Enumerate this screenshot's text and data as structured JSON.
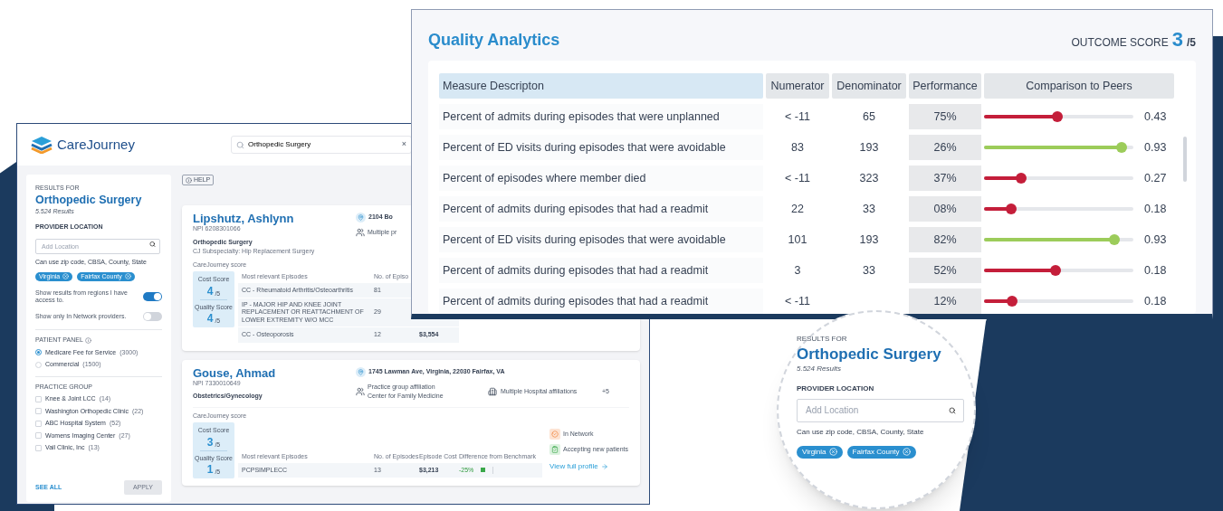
{
  "left_window": {
    "logo": "CareJourney",
    "search": {
      "value": "Orthopedic Surgery",
      "clear": "×"
    },
    "sidebar": {
      "results_for": "RESULTS FOR",
      "query": "Orthopedic Surgery",
      "count": "5.524 Results",
      "location_label": "PROVIDER LOCATION",
      "location_placeholder": "Add Location",
      "location_hint": "Can use zip code, CBSA, County, State",
      "tags": [
        "Virginia",
        "Fairfax County"
      ],
      "toggles": [
        {
          "label": "Show results from regions I have access to.",
          "on": true
        },
        {
          "label": "Show only In Network providers.",
          "on": false
        }
      ],
      "patient_panel": {
        "label": "PATIENT PANEL",
        "options": [
          {
            "label": "Medicare Fee for Service",
            "count": "(3000)",
            "selected": true
          },
          {
            "label": "Commercial",
            "count": "(1500)",
            "selected": false
          }
        ]
      },
      "practice_group": {
        "label": "PRACTICE GROUP",
        "options": [
          {
            "label": "Knee & Joint LCC",
            "count": "(14)",
            "checked": false
          },
          {
            "label": "Washington Orthopedic Clinic",
            "count": "(22)",
            "checked": false
          },
          {
            "label": "ABC Hospital System",
            "count": "(52)",
            "checked": false
          },
          {
            "label": "Womens Imaging Center",
            "count": "(27)",
            "checked": false
          },
          {
            "label": "Vail Clinic, Inc",
            "count": "(13)",
            "checked": false
          }
        ]
      },
      "see_all": "SEE ALL",
      "apply": {
        "label": "APPLY",
        "disabled": true
      }
    },
    "help": "HELP",
    "providers": [
      {
        "name": "Lipshutz, Ashlynn",
        "npi": "NPI 6208301066",
        "specialty": "Orthopedic Surgery",
        "subspecialty": "CJ Subspecialty: Hip Replacement Surgery",
        "address": "2104 Bo",
        "affiliation": "Multiple pr",
        "score_title": "CareJourney score",
        "cost_label": "Cost Score",
        "cost": "4",
        "quality_label": "Quality Score",
        "quality": "4",
        "cost_out_of": "/5",
        "quality_out_of": "/5",
        "columns": [
          "Most relevant Episodes",
          "No. of Episo"
        ],
        "episodes": [
          {
            "name": "CC - Rheumatoid Arthritis/Osteoarthritis",
            "count": "81"
          },
          {
            "name": "IP - MAJOR HIP AND KNEE JOINT REPLACEMENT OR REATTACHMENT OF LOWER EXTREMITY W/O MCC",
            "count": "29"
          },
          {
            "name": "CC - Osteoporosis",
            "count": "12",
            "cost": "$3,554"
          }
        ]
      },
      {
        "name": "Gouse, Ahmad",
        "npi": "NPI 7330010649",
        "specialty": "Obstetrics/Gynecology",
        "address": "1745 Lawman Ave, Virginia, 22030 Fairfax, VA",
        "group_label": "Practice group affiliation",
        "group": "Center for Family Medicine",
        "hospitals": "Multiple Hospital affiliations",
        "hospitals_more": "+5",
        "score_title": "CareJourney score",
        "cost_label": "Cost Score",
        "cost": "3",
        "quality_label": "Quality Score",
        "quality": "1",
        "cost_out_of": "/5",
        "quality_out_of": "/5",
        "columns": [
          "Most relevant Episodes",
          "No. of Episodes",
          "Episode Cost",
          "Difference from Benchmark"
        ],
        "episodes": [
          {
            "name": "PCPSIMPLECC",
            "count": "13",
            "cost": "$3,213",
            "difference": "-25%"
          }
        ],
        "badges": [
          "In Network",
          "Accepting new patients"
        ],
        "profile_link": "View full profile"
      }
    ]
  },
  "analytics": {
    "title": "Quality Analytics",
    "score_label": "OUTCOME SCORE",
    "score": "3",
    "score_of": "/5",
    "columns": [
      "Measure Descripton",
      "Numerator",
      "Denominator",
      "Performance",
      "Comparison to Peers"
    ],
    "rows": [
      {
        "measure": "Percent of admits during episodes that were unplanned",
        "numerator": "< -11",
        "denominator": "65",
        "performance": "75%",
        "level": 0.49,
        "color": "#c41e3a",
        "value": "0.43"
      },
      {
        "measure": "Percent of ED visits during episodes that were avoidable",
        "numerator": "83",
        "denominator": "193",
        "performance": "26%",
        "level": 0.92,
        "color": "#9ccc5a",
        "value": "0.93"
      },
      {
        "measure": "Percent of episodes where member died",
        "numerator": "< -11",
        "denominator": "323",
        "performance": "37%",
        "level": 0.25,
        "color": "#c41e3a",
        "value": "0.27"
      },
      {
        "measure": "Percent of admits during episodes that had a readmit",
        "numerator": "22",
        "denominator": "33",
        "performance": "08%",
        "level": 0.18,
        "color": "#c41e3a",
        "value": "0.18"
      },
      {
        "measure": "Percent of ED visits during episodes that were avoidable",
        "numerator": "101",
        "denominator": "193",
        "performance": "82%",
        "level": 0.87,
        "color": "#9ccc5a",
        "value": "0.93"
      },
      {
        "measure": "Percent of admits during episodes that had a readmit",
        "numerator": "3",
        "denominator": "33",
        "performance": "52%",
        "level": 0.48,
        "color": "#c41e3a",
        "value": "0.18"
      },
      {
        "measure": "Percent of admits during episodes that had a readmit",
        "numerator": "< -11",
        "performance": "12%",
        "level": 0.19,
        "color": "#c41e3a",
        "value": "0.18"
      }
    ]
  },
  "magnifier": {
    "results_for": "RESULTS FOR",
    "query": "Orthopedic Surgery",
    "count": "5.524 Results",
    "location_label": "PROVIDER LOCATION",
    "location_placeholder": "Add Location",
    "location_hint": "Can use zip code, CBSA, County, State",
    "tags": [
      "Virginia",
      "Fairfax County"
    ]
  }
}
